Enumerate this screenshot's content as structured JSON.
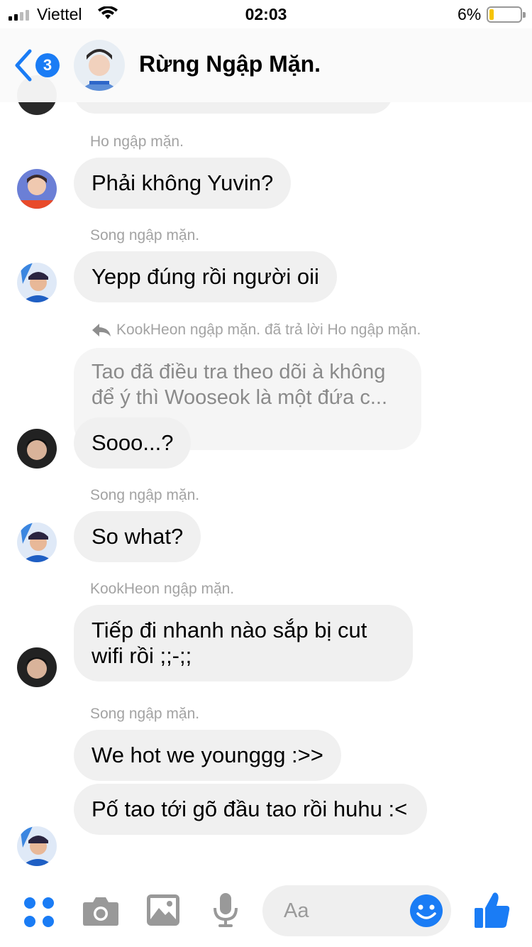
{
  "status_bar": {
    "carrier": "Viettel",
    "time": "02:03",
    "battery": "6%"
  },
  "header": {
    "title": "Rừng Ngập Mặn.",
    "back_count": "3"
  },
  "messages": [
    {
      "sender": "Ho ngập mặn.",
      "text": "Phải không Yuvin?"
    },
    {
      "sender": "Song ngập mặn.",
      "text": "Yepp đúng rồi người oii"
    },
    {
      "reply_note": "KookHeon ngập mặn. đã trả lời Ho ngập mặn.",
      "quoted": "Tao đã điều tra theo dõi à không để ý thì Wooseok là một đứa c...",
      "text": "Sooo...?"
    },
    {
      "sender": "Song ngập mặn.",
      "text": "So what?"
    },
    {
      "sender": "KookHeon ngập mặn.",
      "text": "Tiếp đi nhanh nào sắp bị cut wifi rồi ;;-;;"
    },
    {
      "sender": "Song ngập mặn.",
      "text": "We hot we younggg :>>"
    },
    {
      "text": "Pố tao tới gõ đầu tao rồi huhu :<"
    }
  ],
  "composer": {
    "placeholder": "Aa"
  },
  "colors": {
    "accent": "#1a7cf5",
    "bubble": "#f0f0f0",
    "meta_text": "#a3a3a3"
  },
  "icons": [
    "back-chevron-icon",
    "apps-grid-icon",
    "camera-icon",
    "image-icon",
    "microphone-icon",
    "emoji-icon",
    "thumbs-up-icon",
    "reply-arrow-icon"
  ]
}
